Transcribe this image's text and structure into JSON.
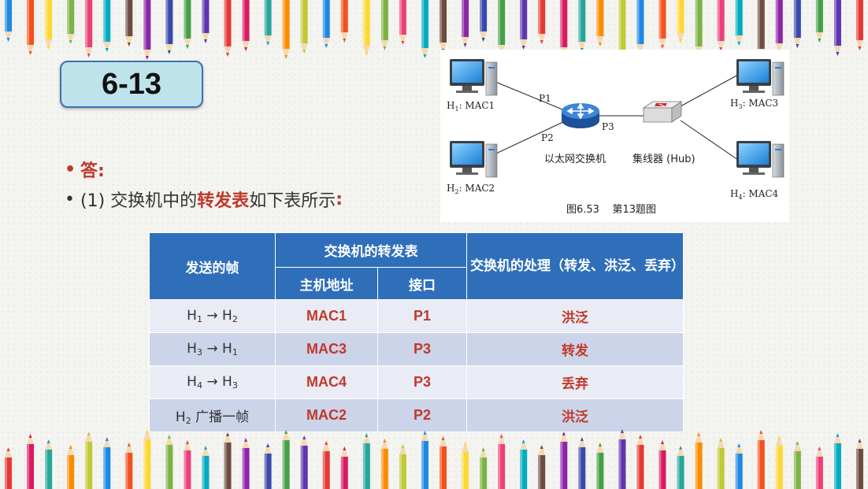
{
  "slide": {
    "problem_number": "6-13",
    "answer_label": "答:",
    "line1": {
      "prefix": "(1) 交换机中的",
      "highlight": "转发表",
      "suffix": "如下表所示",
      "colon": ":"
    }
  },
  "figure": {
    "hosts": [
      {
        "base": "H",
        "sub": "1",
        "suffix": ": MAC1"
      },
      {
        "base": "H",
        "sub": "2",
        "suffix": ": MAC2"
      },
      {
        "base": "H",
        "sub": "3",
        "suffix": ": MAC3"
      },
      {
        "base": "H",
        "sub": "4",
        "suffix": ": MAC4"
      }
    ],
    "ports": [
      "P1",
      "P2",
      "P3"
    ],
    "switch_label": "以太网交换机",
    "hub_label": "集线器 (Hub)",
    "caption": "图6.53    第13题图"
  },
  "table": {
    "headers": {
      "frame": "发送的帧",
      "forward_table": "交换机的转发表",
      "host_address": "主机地址",
      "port": "接口",
      "handling": "交换机的处理（转发、洪泛、丢弃）"
    },
    "rows": [
      {
        "from": "H",
        "from_sub": "1",
        "arrow": " → ",
        "to": "H",
        "to_sub": "2",
        "mac": "MAC1",
        "port": "P1",
        "action": "洪泛"
      },
      {
        "from": "H",
        "from_sub": "3",
        "arrow": " → ",
        "to": "H",
        "to_sub": "1",
        "mac": "MAC3",
        "port": "P3",
        "action": "转发"
      },
      {
        "from": "H",
        "from_sub": "4",
        "arrow": " → ",
        "to": "H",
        "to_sub": "3",
        "mac": "MAC4",
        "port": "P3",
        "action": "丢弃"
      },
      {
        "from": "H",
        "from_sub": "2",
        "arrow": " ",
        "to": "广播一帧",
        "to_sub": "",
        "mac": "MAC2",
        "port": "P2",
        "action": "洪泛"
      }
    ]
  },
  "colors": {
    "accent_red": "#c0392b",
    "header_blue": "#2f6fba",
    "title_box_fill": "#bfe3ea"
  }
}
